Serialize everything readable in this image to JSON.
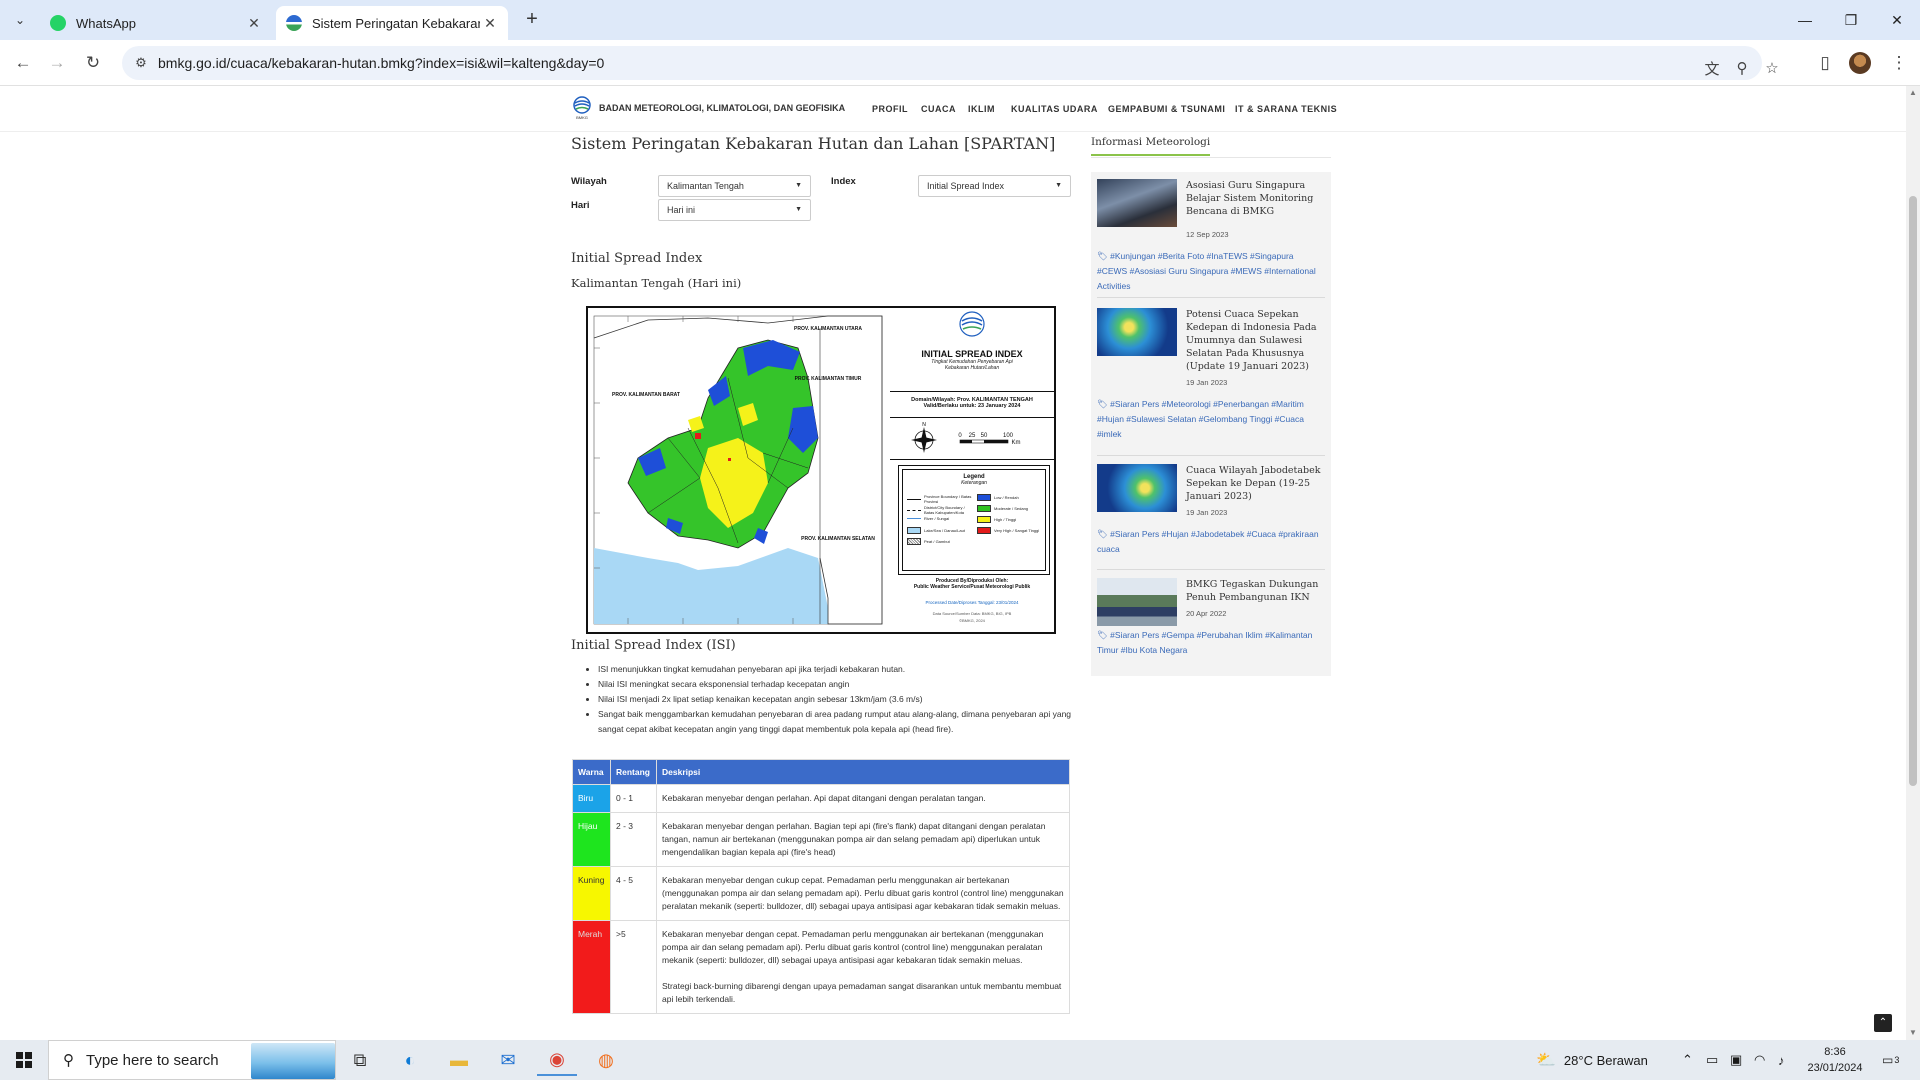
{
  "browser": {
    "tabs": [
      {
        "title": "WhatsApp"
      },
      {
        "title": "Sistem Peringatan Kebakaran H"
      }
    ],
    "url": "bmkg.go.id/cuaca/kebakaran-hutan.bmkg?index=isi&wil=kalteng&day=0"
  },
  "site": {
    "org_name": "BADAN METEOROLOGI, KLIMATOLOGI, DAN GEOFISIKA",
    "logo_text": "BMKG",
    "nav": [
      "PROFIL",
      "CUACA",
      "IKLIM",
      "KUALITAS UDARA",
      "GEMPABUMI & TSUNAMI",
      "IT & SARANA TEKNIS"
    ]
  },
  "content": {
    "title": "Sistem Peringatan Kebakaran Hutan dan Lahan [SPARTAN]",
    "form": {
      "wilayah_label": "Wilayah",
      "wilayah_value": "Kalimantan Tengah",
      "index_label": "Index",
      "index_value": "Initial Spread Index",
      "hari_label": "Hari",
      "hari_value": "Hari ini"
    },
    "section_title": "Initial Spread Index",
    "section_subtitle": "Kalimantan Tengah (Hari ini)",
    "map": {
      "header": "INITIAL SPREAD INDEX",
      "subheader_1": "Tingkat Kemudahan Penyebaran Api",
      "subheader_2": "Kebakaran Hutan/Lahan",
      "domain_line": "Domain/Wilayah: Prov. KALIMANTAN TENGAH",
      "valid_line": "Valid/Berlaku untuk: 23 January 2024",
      "scale": [
        "0",
        "25",
        "50",
        "100",
        "Km"
      ],
      "compass_n": "N",
      "legend_title": "Legend",
      "legend_sub": "Keterangan",
      "legend_boundaries": [
        "Province Boundary / Batas Provinsi",
        "District/City Boundary / Batas Kabupaten/Kota",
        "River / Sungai",
        "Lake/Sea / Danau/Laut",
        "Peat / Gambut"
      ],
      "legend_classes": [
        {
          "label": "Low / Rendah",
          "color": "#1e4fd8"
        },
        {
          "label": "Moderate / Sedang",
          "color": "#2fc21f"
        },
        {
          "label": "High / Tinggi",
          "color": "#f5f21a"
        },
        {
          "label": "Very High / Sangat Tinggi",
          "color": "#e31b1b"
        }
      ],
      "region_labels": [
        "PROV. KALIMANTAN BARAT",
        "PROV. KALIMANTAN TIMUR",
        "PROV. KALIMANTAN UTARA",
        "PROV. KALIMANTAN SELATAN"
      ],
      "produced_by": "Produced By/Diproduksi Oleh:",
      "produced_org": "Public Weather Service/Pusat Meteorologi Publik",
      "processed": "Processed Date/Diproses Tanggal: 23/01/2024",
      "data_source": "Data Source/Sumber Data: BMKG, BIG, IPB",
      "copyright": "©BMKG, 2024"
    },
    "isi_title": "Initial Spread Index (ISI)",
    "isi_points": [
      "ISI menunjukkan tingkat kemudahan penyebaran api jika terjadi kebakaran hutan.",
      "Nilai ISI meningkat secara eksponensial terhadap kecepatan angin",
      "Nilai ISI menjadi 2x lipat setiap kenaikan kecepatan angin sebesar 13km/jam (3.6 m/s)",
      "Sangat baik menggambarkan kemudahan penyebaran di area padang rumput atau alang-alang, dimana penyebaran api yang sangat cepat akibat kecepatan angin yang tinggi dapat membentuk pola kepala api (head fire)."
    ],
    "table": {
      "headers": [
        "Warna",
        "Rentang",
        "Deskripsi"
      ],
      "rows": [
        {
          "color_name": "Biru",
          "color": "#1ba3e8",
          "range": "0 - 1",
          "desc": "Kebakaran menyebar dengan perlahan. Api dapat ditangani dengan peralatan tangan."
        },
        {
          "color_name": "Hijau",
          "color": "#1ee51e",
          "range": "2 - 3",
          "desc": "Kebakaran menyebar dengan perlahan. Bagian tepi api (fire's flank) dapat ditangani dengan peralatan tangan, namun air bertekanan (menggunakan pompa air dan selang pemadam api) diperlukan untuk mengendalikan bagian kepala api (fire's head)"
        },
        {
          "color_name": "Kuning",
          "color": "#f7f700",
          "range": "4 - 5",
          "desc": "Kebakaran menyebar dengan cukup cepat. Pemadaman perlu menggunakan air bertekanan (menggunakan pompa air dan selang pemadam api). Perlu dibuat garis kontrol (control line) menggunakan peralatan mekanik (seperti: bulldozer, dll) sebagai upaya antisipasi agar kebakaran tidak semakin meluas."
        },
        {
          "color_name": "Merah",
          "color": "#f21b1b",
          "range": ">5",
          "desc": "Kebakaran menyebar dengan cepat. Pemadaman perlu menggunakan air bertekanan (menggunakan pompa air dan selang pemadam api). Perlu dibuat garis kontrol (control line) menggunakan peralatan mekanik (seperti: bulldozer, dll) sebagai upaya antisipasi agar kebakaran tidak semakin meluas.",
          "desc2": "Strategi back-burning dibarengi dengan upaya pemadaman sangat disarankan untuk membantu membuat api lebih terkendali."
        }
      ]
    }
  },
  "sidebar": {
    "heading": "Informasi Meteorologi",
    "news": [
      {
        "title": "Asosiasi Guru Singapura Belajar Sistem Monitoring Bencana di BMKG",
        "date": "12 Sep 2023",
        "tags": "#Kunjungan #Berita Foto #InaTEWS #Singapura #CEWS #Asosiasi Guru Singapura #MEWS #International Activities"
      },
      {
        "title": "Potensi Cuaca Sepekan Kedepan di Indonesia Pada Umumnya dan Sulawesi Selatan Pada Khususnya (Update 19 Januari 2023)",
        "date": "19 Jan 2023",
        "tags": "#Siaran Pers #Meteorologi #Penerbangan #Maritim #Hujan #Sulawesi Selatan #Gelombang Tinggi #Cuaca #imlek"
      },
      {
        "title": "Cuaca Wilayah Jabodetabek Sepekan ke Depan (19-25 Januari 2023)",
        "date": "19 Jan 2023",
        "tags": "#Siaran Pers #Hujan #Jabodetabek #Cuaca #prakiraan cuaca"
      },
      {
        "title": "BMKG Tegaskan Dukungan Penuh Pembangunan IKN",
        "date": "20 Apr 2022",
        "tags": "#Siaran Pers #Gempa #Perubahan Iklim #Kalimantan Timur #Ibu Kota Negara"
      }
    ]
  },
  "taskbar": {
    "search_placeholder": "Type here to search",
    "weather": "28°C  Berawan",
    "time": "8:36",
    "date": "23/01/2024",
    "notifications": "3"
  }
}
